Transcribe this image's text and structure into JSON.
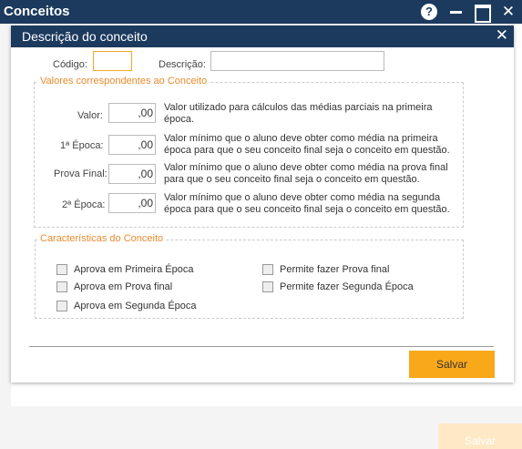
{
  "window": {
    "title": "Conceitos",
    "help_icon": "?",
    "close_glyph": "✕"
  },
  "modal": {
    "title": "Descrição do conceito",
    "close_glyph": "✕"
  },
  "form": {
    "codigo_label": "Código:",
    "descricao_label": "Descrição:"
  },
  "valores": {
    "legend": "Valores correspondentes ao Conceito",
    "rows": [
      {
        "label": "Valor:",
        "value": ",00",
        "desc": "Valor utilizado para cálculos das médias parciais na primeira época."
      },
      {
        "label": "1ª Época:",
        "value": ",00",
        "desc": "Valor mínimo que o aluno deve obter como média na primeira época para que o seu conceito final seja o conceito em questão."
      },
      {
        "label": "Prova Final:",
        "value": ",00",
        "desc": "Valor mínimo que o aluno deve obter como média na prova final para que o seu conceito final seja o conceito em questão."
      },
      {
        "label": "2ª Época:",
        "value": ",00",
        "desc": "Valor mínimo que o aluno deve obter como média na segunda época para que o seu conceito final seja o conceito em questão."
      }
    ]
  },
  "caracteristicas": {
    "legend": "Características do Conceito",
    "checkboxes": [
      "Aprova em Primeira Época",
      "Aprova em Prova final",
      "Aprova em Segunda Época",
      "Permite fazer Prova final",
      "Permite fazer Segunda Época"
    ]
  },
  "actions": {
    "save_label": "Salvar",
    "footer_save_label": "Salvar"
  },
  "colors": {
    "header": "#1c3a5e",
    "accent": "#f9a81a",
    "legend": "#e88b2e"
  }
}
